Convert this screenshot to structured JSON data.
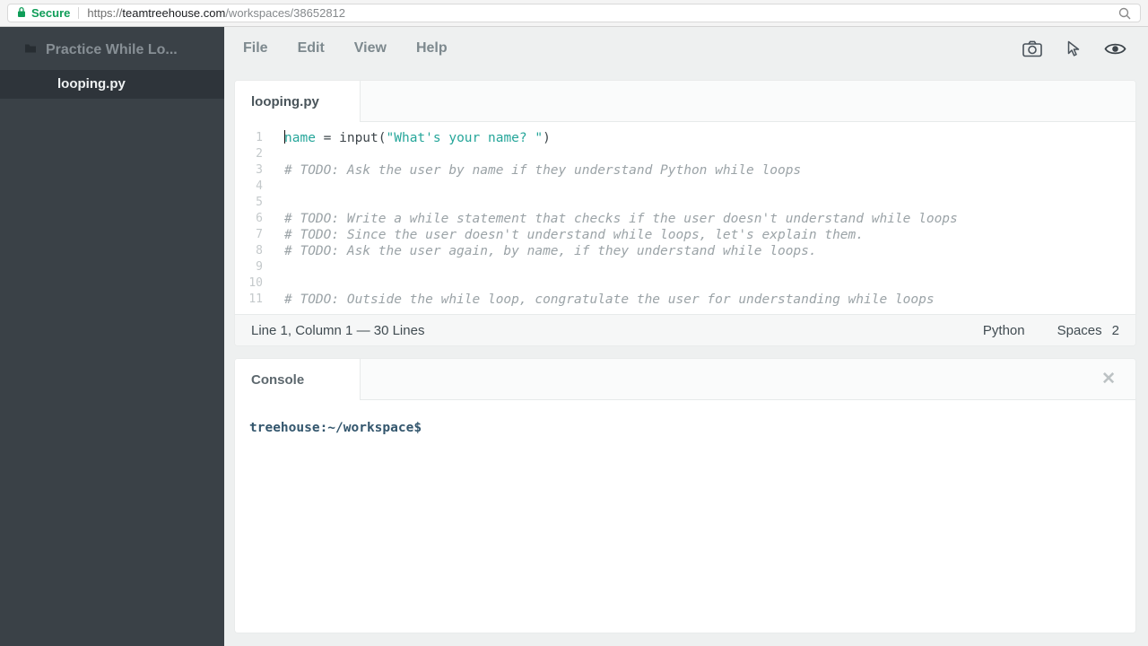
{
  "browser": {
    "secure_label": "Secure",
    "secure_color": "#0f9d58",
    "url_protocol": "https://",
    "url_domain": "teamtreehouse.com",
    "url_path": "/workspaces/38652812"
  },
  "sidebar": {
    "project_title": "Practice While Lo...",
    "files": [
      {
        "name": "looping.py",
        "active": true
      }
    ]
  },
  "menubar": {
    "items": [
      "File",
      "Edit",
      "View",
      "Help"
    ]
  },
  "toolbar": {
    "icons": [
      "camera-icon",
      "pointer-icon",
      "eye-icon"
    ]
  },
  "editor": {
    "tab_label": "looping.py",
    "colors": {
      "default": "#3e464b",
      "accent": "#26a69a",
      "comment": "#9ba3a7",
      "line_number": "#c4c9cb"
    },
    "lines": [
      {
        "num": 1,
        "cursor": true,
        "tokens": [
          {
            "type": "var",
            "text": "name"
          },
          {
            "type": "plain",
            "text": " = input("
          },
          {
            "type": "string",
            "text": "\"What's your name? \""
          },
          {
            "type": "plain",
            "text": ")"
          }
        ]
      },
      {
        "num": 2,
        "tokens": []
      },
      {
        "num": 3,
        "tokens": [
          {
            "type": "comment",
            "text": "# TODO: Ask the user by name if they understand Python while loops"
          }
        ]
      },
      {
        "num": 4,
        "tokens": []
      },
      {
        "num": 5,
        "tokens": []
      },
      {
        "num": 6,
        "tokens": [
          {
            "type": "comment",
            "text": "# TODO: Write a while statement that checks if the user doesn't understand while loops"
          }
        ]
      },
      {
        "num": 7,
        "tokens": [
          {
            "type": "comment",
            "text": "# TODO: Since the user doesn't understand while loops, let's explain them."
          }
        ]
      },
      {
        "num": 8,
        "tokens": [
          {
            "type": "comment",
            "text": "# TODO: Ask the user again, by name, if they understand while loops."
          }
        ]
      },
      {
        "num": 9,
        "tokens": []
      },
      {
        "num": 10,
        "tokens": []
      },
      {
        "num": 11,
        "tokens": [
          {
            "type": "comment",
            "text": "# TODO: Outside the while loop, congratulate the user for understanding while loops"
          }
        ]
      }
    ],
    "status": {
      "left": "Line 1, Column 1 — 30 Lines",
      "language": "Python",
      "indent_label": "Spaces",
      "indent_value": "2"
    }
  },
  "console": {
    "tab_label": "Console",
    "close_glyph": "✕",
    "prompt": "treehouse:~/workspace$",
    "prompt_color": "#33566d"
  }
}
